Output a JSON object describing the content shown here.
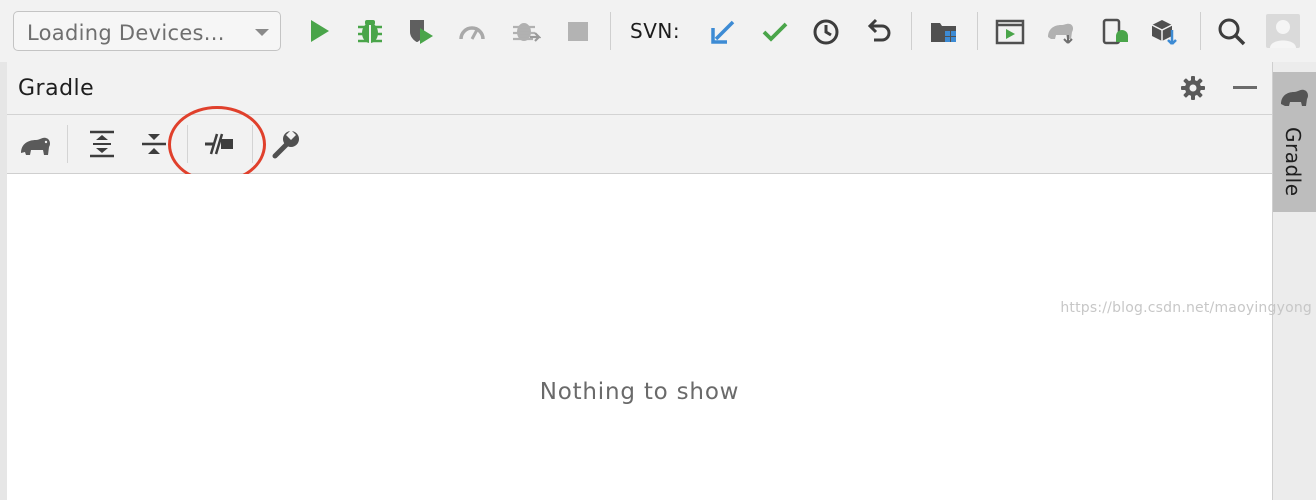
{
  "toolbar": {
    "device_select": "Loading Devices...",
    "svn_label": "SVN:",
    "icons": [
      "run-icon",
      "debug-icon",
      "coverage-icon",
      "profile-icon",
      "attach-debugger-icon",
      "stop-icon",
      "svn-update-icon",
      "svn-commit-icon",
      "svn-history-icon",
      "svn-revert-icon",
      "project-structure-icon",
      "avd-manager-icon",
      "sync-gradle-icon",
      "device-file-explorer-icon",
      "sdk-manager-icon",
      "search-icon",
      "user-avatar"
    ]
  },
  "gradle_panel": {
    "title": "Gradle",
    "toolbar_icons": [
      "gradle-refresh-icon",
      "expand-all-icon",
      "collapse-all-icon",
      "toggle-offline-mode-icon",
      "build-settings-icon"
    ],
    "empty_message": "Nothing to show"
  },
  "right_stripe": {
    "tab_label": "Gradle"
  },
  "watermark": "https://blog.csdn.net/maoyingyong",
  "colors": {
    "run_green": "#4aa54a",
    "svn_blue": "#3d8bd4",
    "highlight_red": "#e0402c"
  }
}
